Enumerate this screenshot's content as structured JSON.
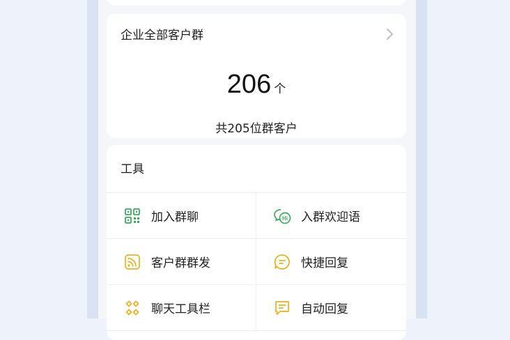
{
  "groups_card": {
    "title": "企业全部客户群",
    "count": "206",
    "unit": "个",
    "subtitle": "共205位群客户"
  },
  "tools": {
    "title": "工具",
    "items": [
      {
        "label": "加入群聊",
        "icon": "qr-code-icon",
        "color": "#3dab5f"
      },
      {
        "label": "入群欢迎语",
        "icon": "chat-hi-icon",
        "color": "#3dab5f"
      },
      {
        "label": "客户群群发",
        "icon": "broadcast-icon",
        "color": "#e6b21e"
      },
      {
        "label": "快捷回复",
        "icon": "message-circle-icon",
        "color": "#e6b21e"
      },
      {
        "label": "聊天工具栏",
        "icon": "toolbar-icon",
        "color": "#e6b21e"
      },
      {
        "label": "自动回复",
        "icon": "message-square-icon",
        "color": "#e6b21e"
      }
    ]
  }
}
